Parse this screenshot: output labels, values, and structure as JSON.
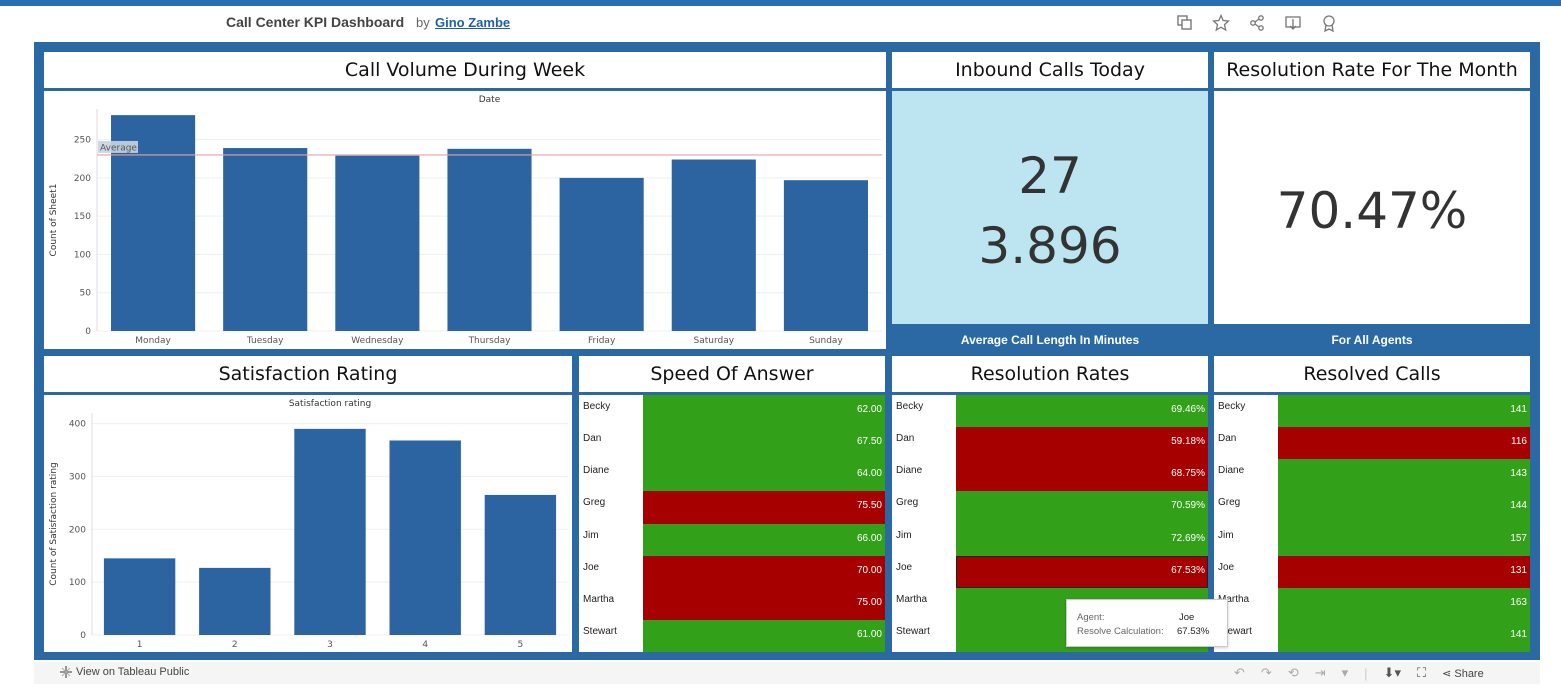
{
  "header": {
    "title": "Call Center KPI Dashboard",
    "by": "by",
    "author": "Gino Zambe"
  },
  "header_icons": [
    "duplicate-icon",
    "star-icon",
    "share-icon",
    "download-icon",
    "badge-icon"
  ],
  "volume": {
    "title": "Call Volume During Week",
    "chart_data": {
      "type": "bar",
      "title": "Date",
      "xlabel": "",
      "ylabel": "Count of Sheet1",
      "categories": [
        "Monday",
        "Tuesday",
        "Wednesday",
        "Thursday",
        "Friday",
        "Saturday",
        "Sunday"
      ],
      "values": [
        282,
        239,
        229,
        238,
        200,
        224,
        197
      ],
      "ylim": [
        0,
        290
      ],
      "yticks": [
        0,
        50,
        100,
        150,
        200,
        250
      ],
      "reference_line": {
        "label": "Average",
        "value": 230
      }
    }
  },
  "inbound": {
    "title": "Inbound Calls Today",
    "value": "27",
    "avg_length": "3.896",
    "caption": "Average Call Length In Minutes",
    "bg": "#bde4f1"
  },
  "resolution_month": {
    "title": "Resolution Rate For The Month",
    "value": "70.47%",
    "caption": "For All Agents"
  },
  "satisfaction": {
    "title": "Satisfaction Rating",
    "chart_data": {
      "type": "bar",
      "title": "Satisfaction rating",
      "xlabel": "",
      "ylabel": "Count of Satisfaction rating",
      "categories": [
        "1",
        "2",
        "3",
        "4",
        "5"
      ],
      "values": [
        145,
        127,
        390,
        368,
        265
      ],
      "ylim": [
        0,
        420
      ],
      "yticks": [
        0,
        100,
        200,
        300,
        400
      ]
    }
  },
  "speed": {
    "title": "Speed Of Answer",
    "rows": [
      {
        "name": "Becky",
        "value": "62.00",
        "status": "good"
      },
      {
        "name": "Dan",
        "value": "67.50",
        "status": "good"
      },
      {
        "name": "Diane",
        "value": "64.00",
        "status": "good"
      },
      {
        "name": "Greg",
        "value": "75.50",
        "status": "bad"
      },
      {
        "name": "Jim",
        "value": "66.00",
        "status": "good"
      },
      {
        "name": "Joe",
        "value": "70.00",
        "status": "bad"
      },
      {
        "name": "Martha",
        "value": "75.00",
        "status": "bad"
      },
      {
        "name": "Stewart",
        "value": "61.00",
        "status": "good"
      }
    ]
  },
  "resolution_rates": {
    "title": "Resolution Rates",
    "rows": [
      {
        "name": "Becky",
        "value": "69.46%",
        "status": "good"
      },
      {
        "name": "Dan",
        "value": "59.18%",
        "status": "bad"
      },
      {
        "name": "Diane",
        "value": "68.75%",
        "status": "bad"
      },
      {
        "name": "Greg",
        "value": "70.59%",
        "status": "good"
      },
      {
        "name": "Jim",
        "value": "72.69%",
        "status": "good"
      },
      {
        "name": "Joe",
        "value": "67.53%",
        "status": "bad"
      },
      {
        "name": "Martha",
        "value": "",
        "status": "good"
      },
      {
        "name": "Stewart",
        "value": "",
        "status": "good"
      }
    ]
  },
  "resolved_calls": {
    "title": "Resolved Calls",
    "rows": [
      {
        "name": "Becky",
        "value": "141",
        "status": "good"
      },
      {
        "name": "Dan",
        "value": "116",
        "status": "bad"
      },
      {
        "name": "Diane",
        "value": "143",
        "status": "good"
      },
      {
        "name": "Greg",
        "value": "144",
        "status": "good"
      },
      {
        "name": "Jim",
        "value": "157",
        "status": "good"
      },
      {
        "name": "Joe",
        "value": "131",
        "status": "bad"
      },
      {
        "name": "Martha",
        "value": "163",
        "status": "good"
      },
      {
        "name": "Stewart",
        "value": "141",
        "status": "good"
      }
    ]
  },
  "tooltip": {
    "agent_label": "Agent:",
    "agent_value": "Joe",
    "calc_label": "Resolve Calculation:",
    "calc_value": "67.53%"
  },
  "colors": {
    "good": "#33a01a",
    "bad": "#a70000",
    "bar": "#2b64a0",
    "dashboard": "#2b69a5"
  },
  "footer": {
    "view_label": "View on Tableau Public",
    "share_label": "Share"
  }
}
